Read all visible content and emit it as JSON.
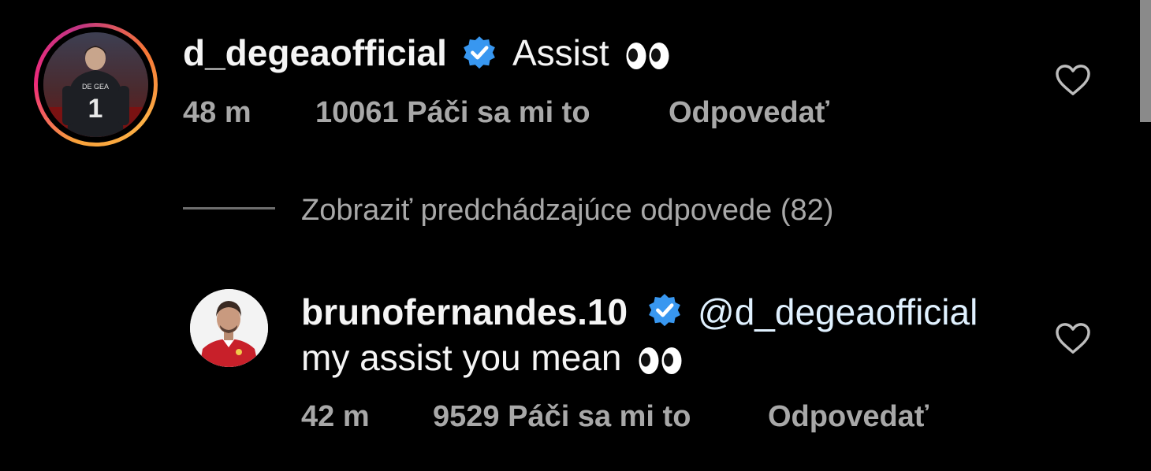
{
  "comment": {
    "username": "d_degeaofficial",
    "text": "Assist",
    "text_emoji": "eyes",
    "time": "48 m",
    "likes": "10061 Páči sa mi to",
    "reply_label": "Odpovedať",
    "avatar_jersey_name": "DE GEA",
    "avatar_jersey_number": "1"
  },
  "replies_toggle": {
    "label": "Zobraziť predchádzajúce odpovede (82)"
  },
  "reply": {
    "username": "brunofernandes.10",
    "mention": "@d_degeaofficial",
    "text": "my assist you mean",
    "text_emoji": "eyes",
    "time": "42 m",
    "likes": "9529 Páči sa mi to",
    "reply_label": "Odpovedať"
  },
  "icons": {
    "verified": "verified-badge-icon",
    "like": "heart-outline-icon"
  },
  "colors": {
    "background": "#000000",
    "verified_blue": "#3897f0",
    "secondary_text": "#a8a8a8",
    "primary_text": "#f5f5f5"
  }
}
